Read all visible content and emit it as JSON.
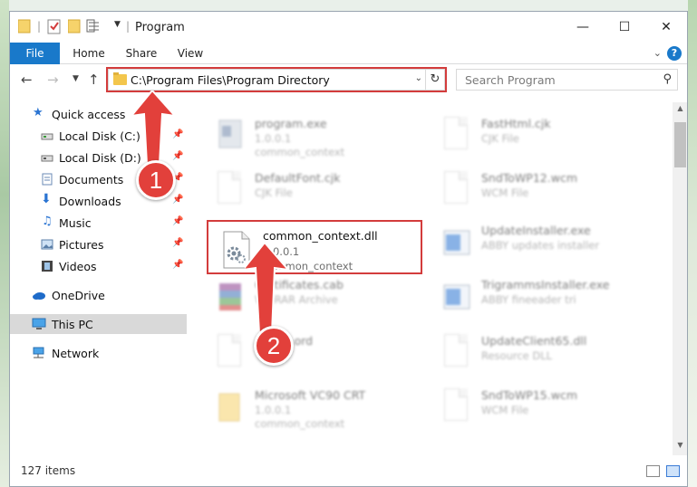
{
  "window": {
    "title": "Program",
    "controls": {
      "minimize": "—",
      "maximize": "☐",
      "close": "✕"
    }
  },
  "ribbon": {
    "tabs": [
      {
        "label": "File",
        "active": true
      },
      {
        "label": "Home"
      },
      {
        "label": "Share"
      },
      {
        "label": "View"
      }
    ],
    "help": "?"
  },
  "nav": {
    "address": "C:\\Program Files\\Program Directory",
    "search_placeholder": "Search Program"
  },
  "sidebar": {
    "items": [
      {
        "label": "Quick access",
        "icon": "star-icon"
      },
      {
        "label": "Local Disk (C:)",
        "icon": "drive-icon",
        "pinned": true
      },
      {
        "label": "Local Disk (D:)",
        "icon": "drive-icon",
        "pinned": true
      },
      {
        "label": "Documents",
        "icon": "documents-icon",
        "pinned": true
      },
      {
        "label": "Downloads",
        "icon": "downloads-icon",
        "pinned": true
      },
      {
        "label": "Music",
        "icon": "music-icon",
        "pinned": true
      },
      {
        "label": "Pictures",
        "icon": "pictures-icon",
        "pinned": true
      },
      {
        "label": "Videos",
        "icon": "videos-icon",
        "pinned": true
      },
      {
        "label": "OneDrive",
        "icon": "cloud-icon"
      },
      {
        "label": "This PC",
        "icon": "computer-icon",
        "selected": true
      },
      {
        "label": "Network",
        "icon": "network-icon"
      }
    ]
  },
  "files": {
    "featured": {
      "name": "common_context.dll",
      "line1": "1.0.0.1",
      "line2": "common_context"
    },
    "left": [
      {
        "name": "program.exe",
        "line1": "1.0.0.1",
        "line2": "common_context",
        "icon": "exe-icon"
      },
      {
        "name": "DefaultFont.cjk",
        "line1": "CJK File",
        "line2": "",
        "icon": "document-icon"
      },
      {
        "name": "Certificates.cab",
        "line1": "WinRAR Archive",
        "line2": "",
        "icon": "archive-icon"
      },
      {
        "name": "Arabic.ord",
        "line1": "",
        "line2": "",
        "icon": "document-icon"
      },
      {
        "name": "Microsoft VC90 CRT",
        "line1": "1.0.0.1",
        "line2": "common_context",
        "icon": "folder-icon"
      }
    ],
    "right": [
      {
        "name": "FastHtml.cjk",
        "line1": "CJK File",
        "line2": "",
        "icon": "document-icon"
      },
      {
        "name": "SndToWP12.wcm",
        "line1": "WCM File",
        "line2": "",
        "icon": "document-icon"
      },
      {
        "name": "UpdateInstaller.exe",
        "line1": "ABBY updates installer",
        "line2": "",
        "icon": "installer-icon"
      },
      {
        "name": "TrigrammsInstaller.exe",
        "line1": "ABBY fineeader tri",
        "line2": "",
        "icon": "installer-icon"
      },
      {
        "name": "UpdateClient65.dll",
        "line1": "Resource DLL",
        "line2": "",
        "icon": "dll-icon"
      },
      {
        "name": "SndToWP15.wcm",
        "line1": "WCM File",
        "line2": "",
        "icon": "document-icon"
      }
    ]
  },
  "status": {
    "count": "127 items"
  },
  "annotations": {
    "badge1": "1",
    "badge2": "2"
  },
  "colors": {
    "accent": "#1979ca",
    "highlight": "#d33c3c",
    "folder": "#f3c64c"
  }
}
